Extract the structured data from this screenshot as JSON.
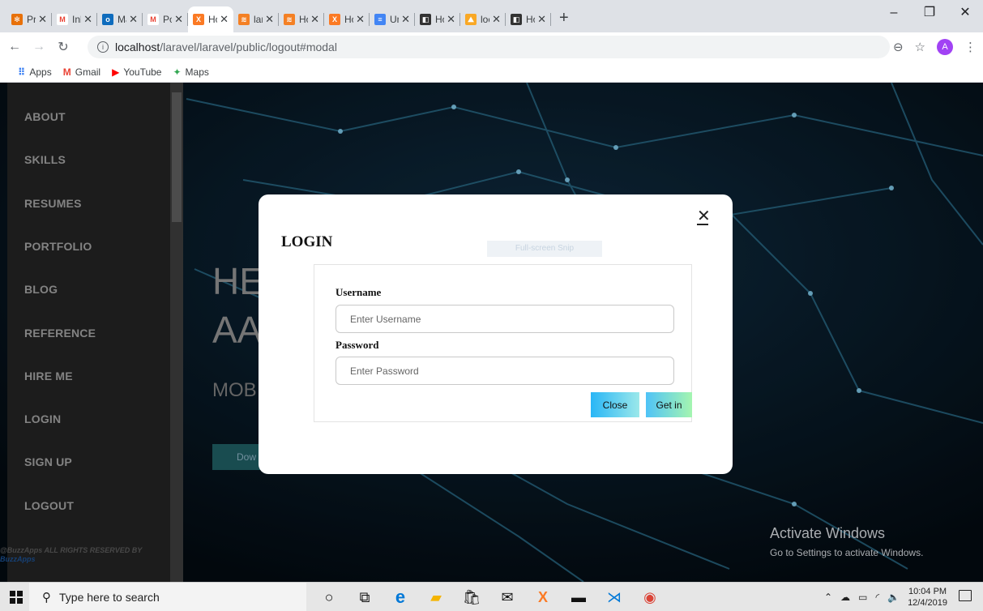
{
  "browser": {
    "tabs": [
      {
        "label": "Proje",
        "fav_color": "#e8710a",
        "fav_glyph": "✻",
        "active": false
      },
      {
        "label": "Inbo",
        "fav_color": "#ffffff",
        "fav_glyph": "M",
        "active": false
      },
      {
        "label": "Mail",
        "fav_color": "#0f6cbd",
        "fav_glyph": "o",
        "active": false
      },
      {
        "label": "Portf",
        "fav_color": "#ffffff",
        "fav_glyph": "M",
        "active": false
      },
      {
        "label": "Hon",
        "fav_color": "#fb7a24",
        "fav_glyph": "X",
        "active": true
      },
      {
        "label": "larav",
        "fav_color": "#f48024",
        "fav_glyph": "≋",
        "active": false
      },
      {
        "label": "How",
        "fav_color": "#f48024",
        "fav_glyph": "≋",
        "active": false
      },
      {
        "label": "Hon",
        "fav_color": "#fb7a24",
        "fav_glyph": "X",
        "active": false
      },
      {
        "label": "Unti",
        "fav_color": "#4285f4",
        "fav_glyph": "≡",
        "active": false
      },
      {
        "label": "How",
        "fav_color": "#333333",
        "fav_glyph": "◧",
        "active": false
      },
      {
        "label": "loca",
        "fav_color": "#f9a825",
        "fav_glyph": "⛰",
        "active": false
      },
      {
        "label": "How",
        "fav_color": "#333333",
        "fav_glyph": "◧",
        "active": false
      }
    ],
    "url_host": "localhost",
    "url_path": "/laravel/laravel/public/logout#modal",
    "profile_initial": "A",
    "bookmarks": [
      {
        "label": "Apps",
        "icon": "apps-grid-icon",
        "glyph": "⠿",
        "color": "#4285f4"
      },
      {
        "label": "Gmail",
        "icon": "gmail-icon",
        "glyph": "M",
        "color": "#ea4335"
      },
      {
        "label": "YouTube",
        "icon": "youtube-icon",
        "glyph": "▶",
        "color": "#ff0000"
      },
      {
        "label": "Maps",
        "icon": "maps-icon",
        "glyph": "✦",
        "color": "#34a853"
      }
    ]
  },
  "sidebar": {
    "items": [
      "ABOUT",
      "SKILLS",
      "RESUMES",
      "PORTFOLIO",
      "BLOG",
      "REFERENCE",
      "HIRE ME",
      "LOGIN",
      "SIGN UP",
      "LOGOUT"
    ],
    "footer_line1": "@BuzzApps ALL RIGHTS RESERVED BY",
    "footer_line2": "BuzzApps"
  },
  "hero": {
    "line1": "HE",
    "line2": "AA",
    "sub": "MOB",
    "button": "Dow"
  },
  "modal": {
    "title": "LOGIN",
    "snip_overlay": "Full-screen Snip",
    "username_label": "Username",
    "username_placeholder": "Enter Username",
    "password_label": "Password",
    "password_placeholder": "Enter Password",
    "close_button": "Close",
    "submit_button": "Get in"
  },
  "watermark": {
    "line1": "Activate Windows",
    "line2": "Go to Settings to activate Windows."
  },
  "taskbar": {
    "search_placeholder": "Type here to search",
    "time": "10:04 PM",
    "date": "12/4/2019"
  }
}
